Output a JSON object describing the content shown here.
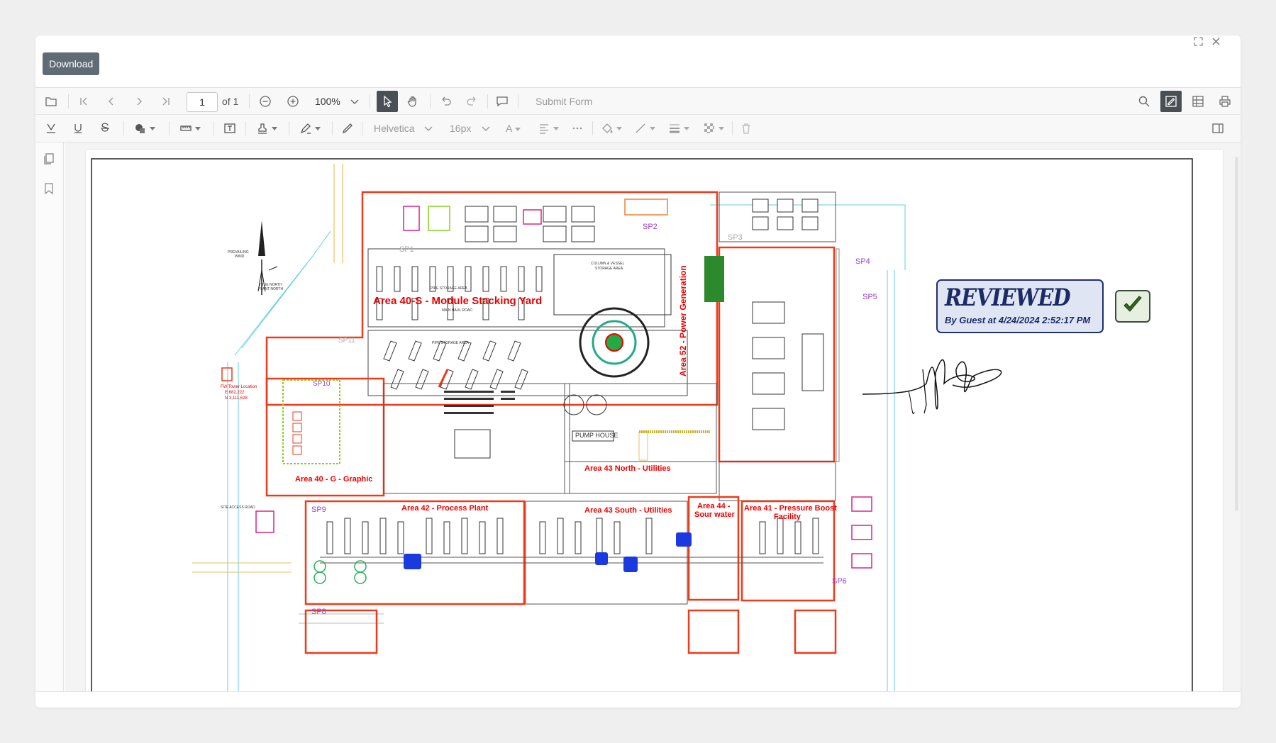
{
  "toolbar": {
    "download_label": "Download",
    "page_number": "1",
    "page_of": "of 1",
    "zoom": "100%",
    "submit_form": "Submit Form"
  },
  "annot_toolbar": {
    "font": "Helvetica",
    "font_size": "16px",
    "text_color_glyph": "A"
  },
  "document": {
    "labels": {
      "area_40s": "Area 40-S - Module Stacking Yard",
      "area_52": "Area 52 - Power Generation",
      "area_40g": "Area 40 - G - Graphic",
      "area_43n": "Area 43 North - Utilities",
      "area_43s": "Area 43 South - Utilities",
      "area_42": "Area 42 - Process Plant",
      "area_44a": "Area 44 -",
      "area_44b": "Sour water",
      "area_41a": "Area 41 - Pressure Boost",
      "area_41b": "Facility",
      "pump_house": "PUMP HOUSE",
      "sp1": "SP1",
      "sp2": "SP2",
      "sp3": "SP3",
      "sp4": "SP4",
      "sp5": "SP5",
      "sp6": "SP6",
      "sp8": "SP8",
      "sp9": "SP9",
      "sp10": "SP10",
      "sp11": "SP11",
      "column_vessel": "COLUMN & VESSEL",
      "storage_area": "STORAGE AREA",
      "pipe_storage": "PIPE STORAGE AREA",
      "main_haul": "MAIN HAUL ROAD",
      "site_access": "SITE ACCESS ROAD",
      "prevailing": "PREVAILING",
      "wind": "WIND",
      "true_north": "TRUE NORTH",
      "plant_north": "PLANT NORTH",
      "fw_tower_a": "FW Tower Location",
      "fw_tower_b": "E 682,222",
      "fw_tower_c": "N 3,111,628"
    },
    "stamp": {
      "title": "REVIEWED",
      "subtitle": "By Guest at 4/24/2024 2:52:17 PM"
    }
  },
  "icons": {
    "colors": {
      "accent_active": "#4a4f55",
      "plan_red": "#e00000",
      "stamp_blue": "#1c2a66"
    }
  }
}
